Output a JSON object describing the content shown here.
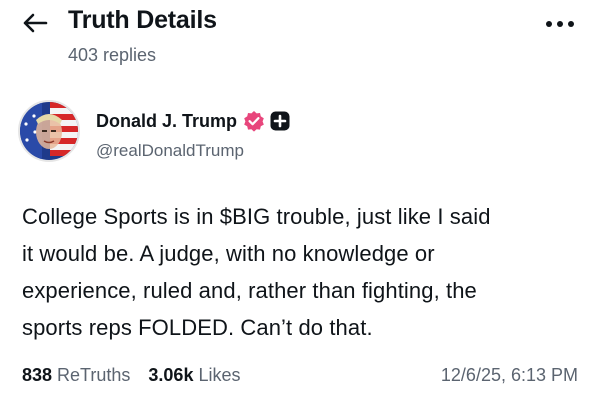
{
  "header": {
    "title": "Truth Details",
    "subtitle": "403 replies"
  },
  "icons": {
    "back": "arrow-left-icon",
    "more": "more-horizontal-icon",
    "verified": "verified-badge-icon",
    "plus": "plus-badge-icon"
  },
  "colors": {
    "verified_badge": "#e8467c",
    "text_primary": "#0f1419",
    "text_secondary": "#5b6470"
  },
  "post": {
    "author": {
      "name": "Donald J. Trump",
      "handle": "@realDonaldTrump"
    },
    "lines": [
      "College Sports is in $BIG trouble, just like I said",
      "it would be. A judge, with no knowledge or",
      "experience, ruled and, rather than fighting, the",
      "sports reps FOLDED. Can’t do that."
    ],
    "stats": {
      "retruths_count": "838",
      "retruths_label": "ReTruths",
      "likes_count": "3.06k",
      "likes_label": "Likes"
    },
    "timestamp": "12/6/25, 6:13 PM"
  }
}
